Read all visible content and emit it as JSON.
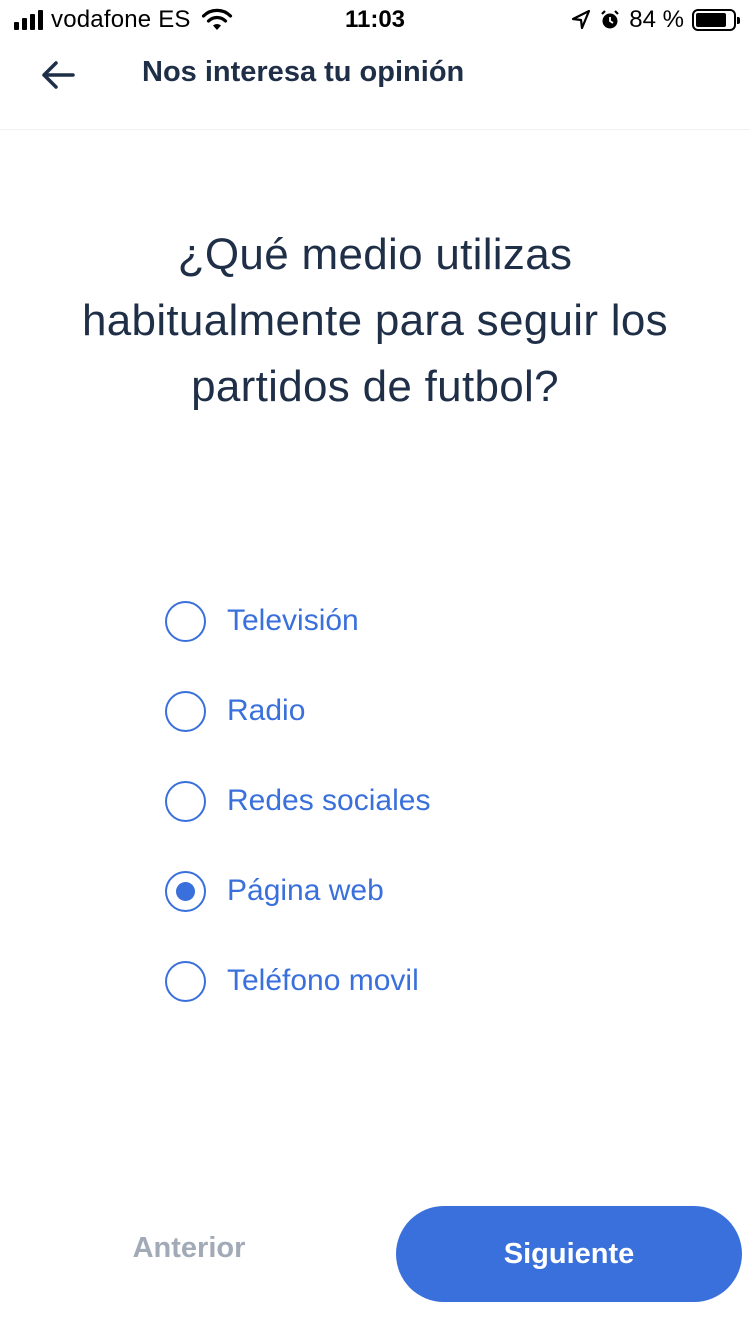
{
  "status_bar": {
    "carrier": "vodafone ES",
    "time": "11:03",
    "battery": "84 %",
    "battery_level": 0.84
  },
  "header": {
    "title": "Nos interesa tu opinión",
    "back_icon": "arrow-left-icon"
  },
  "question": {
    "line1": "¿Qué medio utilizas",
    "line2": "habitualmente para seguir los",
    "line3": "partidos de futbol?"
  },
  "options": [
    {
      "label": "Televisión",
      "selected": false
    },
    {
      "label": "Radio",
      "selected": false
    },
    {
      "label": "Redes sociales",
      "selected": false
    },
    {
      "label": "Página web",
      "selected": true
    },
    {
      "label": "Teléfono movil",
      "selected": false
    }
  ],
  "footer": {
    "prev_label": "Anterior",
    "next_label": "Siguiente"
  },
  "colors": {
    "accent": "#3a70dc",
    "title_text": "#1f2f47",
    "disabled_text": "#a1aab6"
  }
}
